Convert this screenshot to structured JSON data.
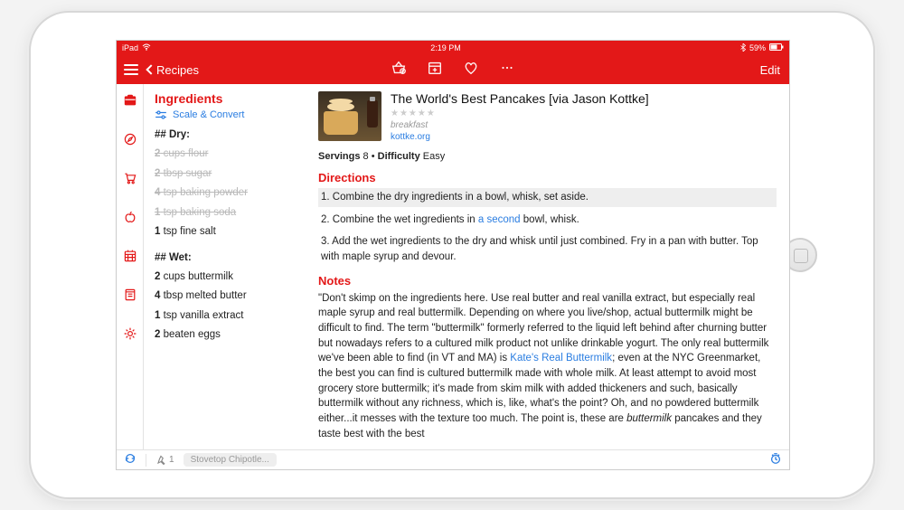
{
  "status": {
    "carrier": "iPad",
    "time": "2:19 PM",
    "battery": "59%"
  },
  "nav": {
    "back_label": "Recipes",
    "edit_label": "Edit"
  },
  "ingredients": {
    "title": "Ingredients",
    "scale_label": "Scale & Convert",
    "group1_header": "## Dry:",
    "dry": [
      {
        "q": "2",
        "text": "cups flour",
        "struck": true
      },
      {
        "q": "2",
        "text": "tbsp sugar",
        "struck": true
      },
      {
        "q": "4",
        "text": "tsp baking powder",
        "struck": true
      },
      {
        "q": "1",
        "text": "tsp baking soda",
        "struck": true
      },
      {
        "q": "1",
        "text": "tsp fine salt",
        "struck": false
      }
    ],
    "group2_header": "## Wet:",
    "wet": [
      {
        "q": "2",
        "text": "cups buttermilk"
      },
      {
        "q": "4",
        "text": "tbsp melted butter"
      },
      {
        "q": "1",
        "text": "tsp vanilla extract"
      },
      {
        "q": "2",
        "text": "beaten eggs"
      }
    ]
  },
  "recipe": {
    "title": "The World's Best Pancakes [via Jason Kottke]",
    "stars": "★★★★★",
    "categories": "breakfast",
    "source": "kottke.org",
    "servings_label": "Servings",
    "servings_value": "8",
    "difficulty_label": "Difficulty",
    "difficulty_value": "Easy"
  },
  "directions": {
    "header": "Directions",
    "steps": {
      "s1": "1. Combine the dry ingredients in a bowl, whisk, set aside.",
      "s2a": "2. Combine the wet ingredients in ",
      "s2_link": "a second",
      "s2b": " bowl, whisk.",
      "s3": "3. Add the wet ingredients to the dry and whisk until just combined. Fry in a pan with butter. Top with maple syrup and devour."
    }
  },
  "notes": {
    "header": "Notes",
    "p1a": "\"Don't skimp on the ingredients here. Use real butter and real vanilla extract, but especially real maple syrup and real buttermilk. Depending on where you live/shop, actual buttermilk might be difficult to find. The term \"buttermilk\" formerly referred to the liquid left behind after churning butter but nowadays refers to a cultured milk product not unlike drinkable yogurt. The only real buttermilk we've been able to find (in VT and MA) is ",
    "p1_link": "Kate's Real Buttermilk",
    "p1b": "; even at the NYC Greenmarket, the best you can find is cultured buttermilk made with whole milk. At least attempt to avoid most grocery store buttermilk; it's made from skim milk with added thickeners and such, basically buttermilk without any richness, which is, like, what's the point? Oh, and no powdered buttermilk either...it messes with the texture too much. The point is, these are ",
    "p1_em": "buttermilk",
    "p1c": " pancakes and they taste best with the best"
  },
  "footer": {
    "pin_count": "1",
    "chip": "Stovetop Chipotle..."
  }
}
